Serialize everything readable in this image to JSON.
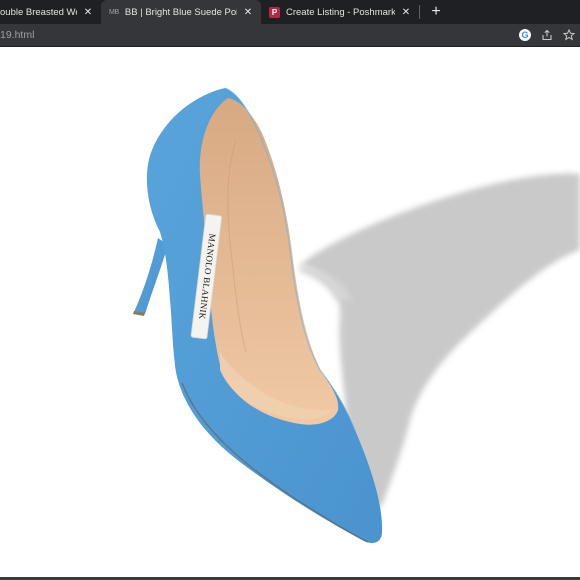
{
  "tabs": [
    {
      "favicon": "",
      "title": "ouble Breasted Wool B",
      "active": false
    },
    {
      "favicon": "MB",
      "title": "BB | Bright Blue Suede Pointed To",
      "active": true
    },
    {
      "favicon": "poshmark-icon",
      "title": "Create Listing - Poshmark",
      "active": false
    }
  ],
  "toolbar": {
    "url": "19.html",
    "icons": [
      "google-icon",
      "share-icon",
      "bookmark-star-icon"
    ]
  },
  "product_image": {
    "label": "MANOLO BLAHNIK",
    "colors": {
      "suede": "#4f9ad4",
      "lining": "#e4b894",
      "shadow": "#c7c7c7"
    }
  }
}
